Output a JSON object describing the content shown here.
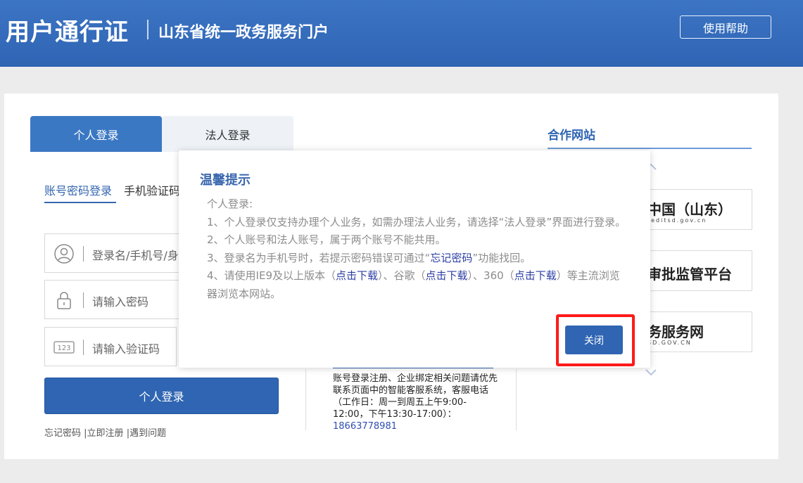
{
  "header": {
    "title": "用户通行证",
    "subtitle": "山东省统一政务服务门户",
    "help_label": "使用帮助"
  },
  "login": {
    "tabs": [
      "个人登录",
      "法人登录"
    ],
    "subtabs": [
      "账号密码登录",
      "手机验证码"
    ],
    "username_placeholder": "登录名/手机号/身",
    "password_placeholder": "请输入密码",
    "captcha_placeholder": "请输入验证码",
    "submit_label": "个人登录",
    "links": [
      "忘记密码",
      "|立即注册",
      "|遇到问题"
    ]
  },
  "service": {
    "text": "账号登录注册、企业绑定相关问题请优先联系页面中的智能客服系统，客服电话（工作日：周一到周五上午9:00-12:00，下午13:30-17:00）：",
    "phone": "18663778981"
  },
  "partners": {
    "title": "合作网站",
    "items": [
      {
        "big": "中国（山东）",
        "small": "reditsd.gov.cn"
      },
      {
        "big": "审批监管平台",
        "small": ""
      },
      {
        "big": "务服务网",
        "small": "SD.GOV.CN"
      }
    ]
  },
  "modal": {
    "title": "温馨提示",
    "intro": "个人登录:",
    "line1": "1、个人登录仅支持办理个人业务，如需办理法人业务，请选择“法人登录”界面进行登录。",
    "line2": "2、个人账号和法人账号，属于两个账号不能共用。",
    "line3_a": "3、登录名为手机号时，若提示密码错误可通过“",
    "line3_link": "忘记密码",
    "line3_b": "”功能找回。",
    "line4_a": "4、请使用IE9及以上版本（",
    "link_dl": "点击下载",
    "line4_b": "）、谷歌（",
    "line4_c": "）、360（",
    "line4_d": "）等主流浏览器浏览本网站。",
    "close_label": "关闭"
  },
  "colors": {
    "header_bg": "#3368b8",
    "accent": "#2f65b2",
    "highlight": "#ff1a1a"
  }
}
